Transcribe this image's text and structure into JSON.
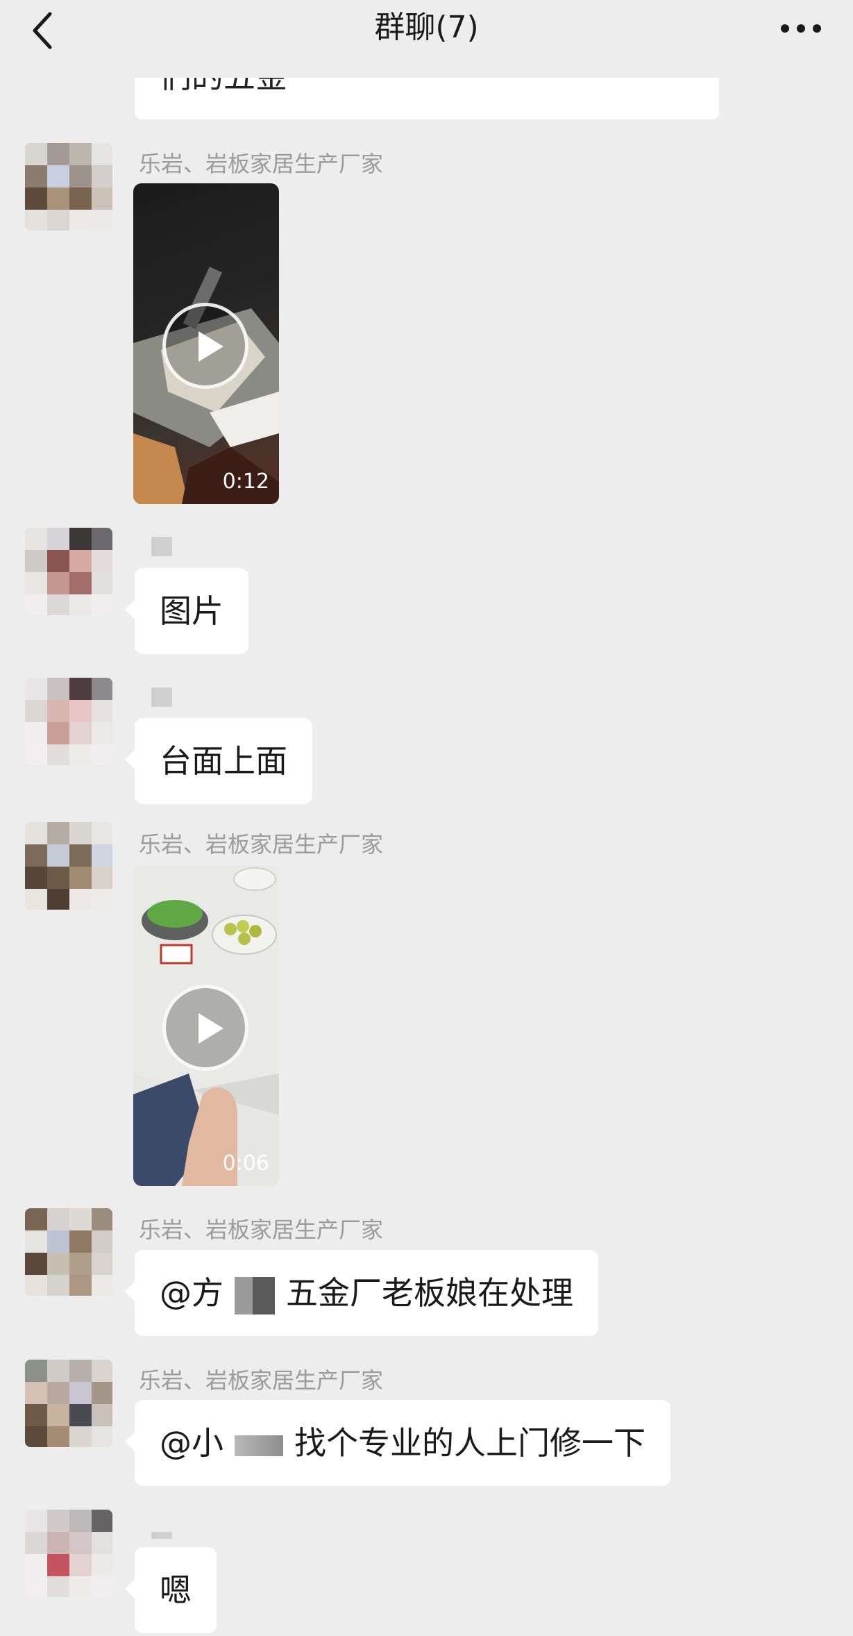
{
  "header": {
    "title": "群聊(7)",
    "back_icon": "chevron-left-icon",
    "more_icon": "ellipsis-icon"
  },
  "messages": {
    "partial_text": "们的五金",
    "m1": {
      "sender": "乐岩、岩板家居生产厂家",
      "video_duration": "0:12"
    },
    "m2": {
      "text": "图片"
    },
    "m3": {
      "text": "台面上面"
    },
    "m4": {
      "sender": "乐岩、岩板家居生产厂家",
      "video_duration": "0:06"
    },
    "m5": {
      "sender": "乐岩、岩板家居生产厂家",
      "text_before": "@方",
      "text_after": "五金厂老板娘在处理"
    },
    "m6": {
      "sender": "乐岩、岩板家居生产厂家",
      "text_before": "@小",
      "text_after": "找个专业的人上门修一下"
    },
    "m7": {
      "text": "嗯"
    }
  },
  "colors": {
    "background": "#ededed",
    "bubble": "#ffffff",
    "sender_name": "#9b9b9b",
    "text": "#1a1a1a"
  }
}
